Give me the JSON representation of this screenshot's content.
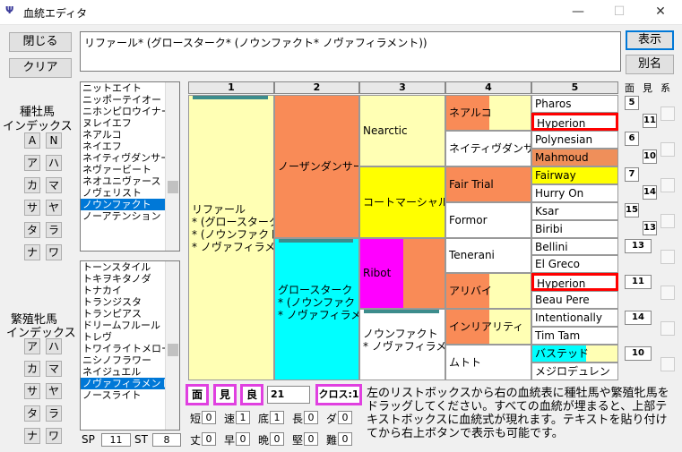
{
  "window": {
    "title": "血統エディタ",
    "min": "—",
    "max": "☐",
    "close": "✕"
  },
  "buttons": {
    "close": "閉じる",
    "clear": "クリア",
    "show": "表示",
    "alias": "別名"
  },
  "formula": "リファール* (グロースターク* (ノウンファクト* ノヴァフィラメント))",
  "sire_index": {
    "label1": "種牡馬",
    "label2": "インデックス",
    "keys": [
      "A",
      "N",
      "ア",
      "ハ",
      "カ",
      "マ",
      "サ",
      "ヤ",
      "タ",
      "ラ",
      "ナ",
      "ワ"
    ],
    "items": [
      "ニットエイト",
      "ニッポーテイオー",
      "ニホンピロウイナー",
      "ヌレイエフ",
      "ネアルコ",
      "ネイエフ",
      "ネイティヴダンサー",
      "ネヴァービート",
      "ネオユニヴァース",
      "ノヴェリスト",
      "ノウンファクト",
      "ノーアテンション"
    ],
    "selected": 10
  },
  "mare_index": {
    "label1": "繁殖牝馬",
    "label2": "インデックス",
    "keys": [
      "ア",
      "ハ",
      "カ",
      "マ",
      "サ",
      "ヤ",
      "タ",
      "ラ",
      "ナ",
      "ワ"
    ],
    "items": [
      "トーンスタイル",
      "トキヲキタノダ",
      "トナカイ",
      "トランジスタ",
      "トランピアス",
      "ドリームフルール",
      "トレヴ",
      "トワイライトメロー",
      "ニシノフラワー",
      "ネイジュエル",
      "ノヴァフィラメント",
      "ノースライト"
    ],
    "selected": 10
  },
  "sp": {
    "label": "SP",
    "value": "11"
  },
  "st": {
    "label": "ST",
    "value": "8"
  },
  "columns": [
    "1",
    "2",
    "3",
    "4",
    "5"
  ],
  "right_headers": [
    "面",
    "見",
    "系"
  ],
  "pedigree": {
    "g1": [
      "リファール\n* (グロースターク\n* (ノウンファクト\n* ノヴァフィラメント"
    ],
    "g2": [
      "ノーザンダンサー",
      "グロースターク\n* (ノウンファクト\n* ノヴァフィラメント"
    ],
    "g3": [
      "Nearctic",
      "コートマーシャル",
      "Ribot",
      "ノウンファクト\n* ノヴァフィラメント"
    ],
    "g4": [
      "ネアルコ",
      "ネイティヴダンサー",
      "Fair Trial",
      "Formor",
      "Tenerani",
      "アリバイ",
      "インリアリティ",
      "ムトト"
    ],
    "g5": [
      "Pharos",
      "Hyperion",
      "Polynesian",
      "Mahmoud",
      "Fairway",
      "Hurry On",
      "Ksar",
      "Biribi",
      "Bellini",
      "El Greco",
      "Hyperion",
      "Beau Pere",
      "Intentionally",
      "Tim Tam",
      "バステッド",
      "メジロデュレン"
    ]
  },
  "side_numbers": {
    "men": [
      "5",
      "6",
      "7",
      "15",
      "13",
      "11",
      "14",
      "10"
    ],
    "mi": [
      "11",
      "10",
      "14",
      "13"
    ]
  },
  "bottom": {
    "men": "面",
    "mi": "見",
    "ryo": "良",
    "count": "21",
    "cross": "クロス:1",
    "stats": [
      {
        "label": "短",
        "value": "0"
      },
      {
        "label": "速",
        "value": "1"
      },
      {
        "label": "底",
        "value": "1"
      },
      {
        "label": "長",
        "value": "0"
      },
      {
        "label": "ダ",
        "value": "0"
      },
      {
        "label": "丈",
        "value": "0"
      },
      {
        "label": "早",
        "value": "0"
      },
      {
        "label": "晩",
        "value": "0"
      },
      {
        "label": "堅",
        "value": "0"
      },
      {
        "label": "難",
        "value": "0"
      }
    ],
    "help": "左のリストボックスから右の血統表に種牡馬や繁殖牝馬をドラッグしてください。すべての血統が埋まると、上部テキストボックスに血統式が現れます。テキストを貼り付けてから右上ボタンで表示も可能です。"
  },
  "colors": {
    "orange": "#f98b57",
    "yellow": "#ffffb4",
    "brightyellow": "#ffff00",
    "cyan": "#00ffff",
    "magenta": "#ff00ff",
    "teal": "#3c8c8c",
    "red": "#ff0000",
    "mahmoud": "#ef8f5a"
  }
}
